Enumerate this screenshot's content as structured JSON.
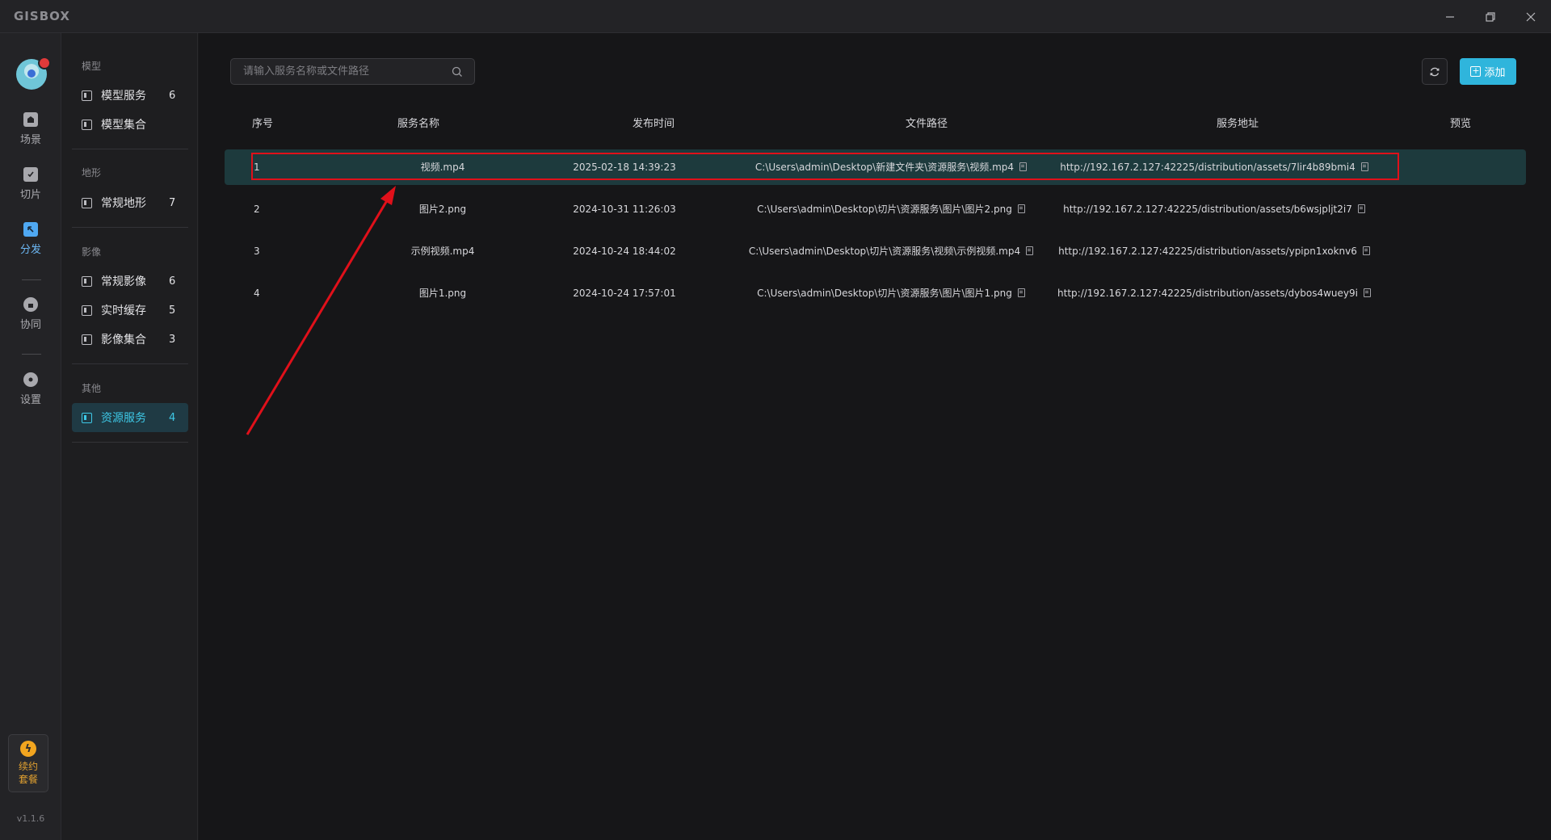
{
  "app": {
    "logo_text": "GISBOX"
  },
  "rail": {
    "items": [
      {
        "label": "场景",
        "icon": "scene-icon"
      },
      {
        "label": "切片",
        "icon": "tile-icon"
      },
      {
        "label": "分发",
        "icon": "distribute-icon"
      },
      {
        "label": "协同",
        "icon": "collaborate-icon"
      },
      {
        "label": "设置",
        "icon": "settings-icon"
      }
    ],
    "active": "分发",
    "renew_label": "续约套餐",
    "version": "v1.1.6"
  },
  "sidebar": {
    "groups": [
      {
        "title": "模型",
        "items": [
          {
            "label": "模型服务",
            "count": "6"
          },
          {
            "label": "模型集合",
            "count": ""
          }
        ]
      },
      {
        "title": "地形",
        "items": [
          {
            "label": "常规地形",
            "count": "7"
          }
        ]
      },
      {
        "title": "影像",
        "items": [
          {
            "label": "常规影像",
            "count": "6"
          },
          {
            "label": "实时缓存",
            "count": "5"
          },
          {
            "label": "影像集合",
            "count": "3"
          }
        ]
      },
      {
        "title": "其他",
        "items": [
          {
            "label": "资源服务",
            "count": "4"
          }
        ]
      }
    ],
    "active": "资源服务"
  },
  "toolbar": {
    "search_placeholder": "请输入服务名称或文件路径",
    "add_label": "添加"
  },
  "table": {
    "headers": {
      "index": "序号",
      "name": "服务名称",
      "time": "发布时间",
      "path": "文件路径",
      "url": "服务地址",
      "preview": "预览"
    },
    "rows": [
      {
        "index": "1",
        "name": "视频.mp4",
        "time": "2025-02-18 14:39:23",
        "path": "C:\\Users\\admin\\Desktop\\新建文件夹\\资源服务\\视频.mp4",
        "url": "http://192.167.2.127:42225/distribution/assets/7lir4b89bmi4",
        "selected": true
      },
      {
        "index": "2",
        "name": "图片2.png",
        "time": "2024-10-31 11:26:03",
        "path": "C:\\Users\\admin\\Desktop\\切片\\资源服务\\图片\\图片2.png",
        "url": "http://192.167.2.127:42225/distribution/assets/b6wsjpljt2i7",
        "selected": false
      },
      {
        "index": "3",
        "name": "示例视频.mp4",
        "time": "2024-10-24 18:44:02",
        "path": "C:\\Users\\admin\\Desktop\\切片\\资源服务\\视频\\示例视频.mp4",
        "url": "http://192.167.2.127:42225/distribution/assets/ypipn1xoknv6",
        "selected": false
      },
      {
        "index": "4",
        "name": "图片1.png",
        "time": "2024-10-24 17:57:01",
        "path": "C:\\Users\\admin\\Desktop\\切片\\资源服务\\图片\\图片1.png",
        "url": "http://192.167.2.127:42225/distribution/assets/dybos4wuey9i",
        "selected": false
      }
    ]
  },
  "colors": {
    "accent": "#2fb5dc",
    "selected_row": "#1d3a3d",
    "annotation": "#e0101a"
  }
}
